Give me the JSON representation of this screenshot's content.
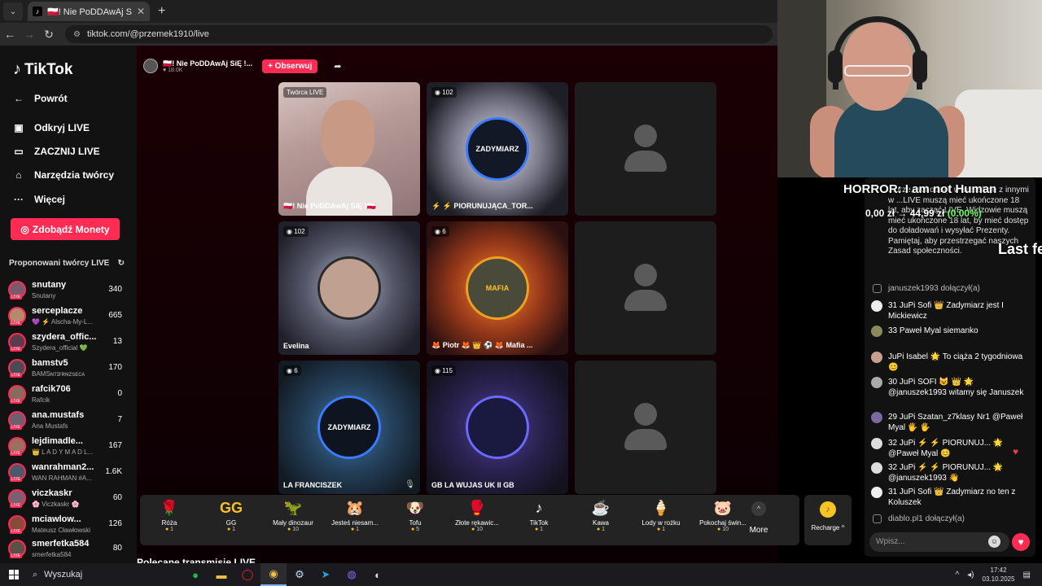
{
  "browser": {
    "tab_title": "🇵🇱! Nie PoDDAwAj SiĘ 🇵🇱! I",
    "url": "tiktok.com/@przemek1910/live"
  },
  "sidebar": {
    "logo": "TikTok",
    "back": "Powrót",
    "nav": [
      "Odkryj LIVE",
      "ZACZNIJ LIVE",
      "Narzędzia twórcy",
      "Więcej"
    ],
    "coins_button": "Zdobądź Monety",
    "suggested_title": "Proponowani twórcy LIVE",
    "creators": [
      {
        "name": "snutany",
        "sub": "Snutany",
        "count": "340"
      },
      {
        "name": "serceplacze",
        "sub": "💜 ⚡ Alscha-My-L...",
        "count": "665"
      },
      {
        "name": "szydera_offic...",
        "sub": "Szydera_official 💚",
        "count": "13"
      },
      {
        "name": "bamstv5",
        "sub": "BAMSɴᴛɪғʀɴᴢsᴇᴄᴀ",
        "count": "170"
      },
      {
        "name": "rafcik706",
        "sub": "Rafcik",
        "count": "0"
      },
      {
        "name": "ana.mustafs",
        "sub": "Ana Mustafs",
        "count": "7"
      },
      {
        "name": "lejdimadle...",
        "sub": "👑 L A D Y M A D L...",
        "count": "167"
      },
      {
        "name": "wanrahman2...",
        "sub": "WAN RAHMAN #A...",
        "count": "1.6K"
      },
      {
        "name": "viczkaskr",
        "sub": "🌸 Viczkaskr 🌸",
        "count": "60"
      },
      {
        "name": "mciawlow...",
        "sub": "Mateusz Cławłowski",
        "count": "126"
      },
      {
        "name": "smerfetka584",
        "sub": "smerfetka584",
        "count": "80"
      }
    ]
  },
  "host": {
    "name": "🇵🇱! Nie PoDDAwAj SiĘ !...",
    "likes": "♥ 18.0K",
    "follow": "+ Obserwuj"
  },
  "grid": {
    "creator_badge": "Twórca LIVE",
    "cells": [
      {
        "label": "🇵🇱! Nie PoDDAwAj SiĘ !🇵🇱",
        "count": ""
      },
      {
        "label": "⚡ ⚡ PIORUNUJĄCA_TOR...",
        "count": "102",
        "avatar": "ZADYMIARZ"
      },
      {
        "label": "",
        "count": ""
      },
      {
        "label": "Evelina",
        "count": "102"
      },
      {
        "label": "🦊 Piotr 🦊 👑 ⚽ 🦊 Mafia ...",
        "count": "6",
        "avatar": "MAFIA"
      },
      {
        "label": "",
        "count": ""
      },
      {
        "label": "LA FRANCISZEK",
        "count": "6",
        "avatar": "ZADYMIARZ"
      },
      {
        "label": "GB LA WUJAS UK II GB",
        "count": "115"
      },
      {
        "label": "",
        "count": ""
      }
    ]
  },
  "gifts": [
    {
      "name": "Róża",
      "price": "1",
      "icon": "🌹"
    },
    {
      "name": "GG",
      "price": "1",
      "icon": "GG"
    },
    {
      "name": "Mały dinozaur",
      "price": "10",
      "icon": "🦖"
    },
    {
      "name": "Jesteś niesam...",
      "price": "1",
      "icon": "🐹"
    },
    {
      "name": "Tofu",
      "price": "5",
      "icon": "🐶"
    },
    {
      "name": "Złote rękawic...",
      "price": "10",
      "icon": "🥊"
    },
    {
      "name": "TikTok",
      "price": "1",
      "icon": "♪"
    },
    {
      "name": "Kawa",
      "price": "1",
      "icon": "☕"
    },
    {
      "name": "Lody w rożku",
      "price": "1",
      "icon": "🍦"
    },
    {
      "name": "Pokochaj świn...",
      "price": "10",
      "icon": "🐷"
    }
  ],
  "more_label": "More",
  "recharge_label": "Recharge ^",
  "recommended": "Polecane transmisje LIVE",
  "overlay": {
    "game_title": "HORROR: I am not Human",
    "price_line": "0,00 zł → 44,99 zł",
    "price_change": "(0.00%)",
    "last": "Last fe"
  },
  "chat": {
    "rules": "...brze, wchodząc w interakcje z innymi w ...LIVE muszą mieć ukończone 18 lat, aby zacząć LIVE. Widzowie muszą mieć ukończone 18 lat, by mieć dostęp do doładowań i wysyłać Prezenty. Pamiętaj, aby przestrzegać naszych Zasad społeczności.",
    "messages": [
      {
        "text": "januszek1993 dołączył(a)"
      },
      {
        "text": "31 JuPi Sofi 👑 Zadymiarz jest I Mickiewicz"
      },
      {
        "text": "33 Paweł Myal siemanko"
      },
      {
        "text": "JuPi Isabel 🌟 To ciąża 2 tygodniowa 😊"
      },
      {
        "text": "30 JuPi SOFI 😺 👑 🌟 @januszek1993 witamy się Januszek"
      },
      {
        "text": "29 JuPi Szatan_z7klasy Nr1 @Paweł Myal 🖐 🖐"
      },
      {
        "text": "32 JuPi ⚡ ⚡ PIORUNUJ... 🌟 @Paweł Myal 😊"
      },
      {
        "text": "32 JuPi ⚡ ⚡ PIORUNUJ... 🌟 @januszek1993 👋"
      },
      {
        "text": "31 JuPi Sofi 👑 Zadymiarz no ten z Koluszek"
      },
      {
        "text": "diablo.pl1 dołączył(a)"
      }
    ],
    "placeholder": "Wpisz..."
  },
  "taskbar": {
    "search": "Wyszukaj",
    "time": "17:42",
    "date": "03.10.2025"
  }
}
